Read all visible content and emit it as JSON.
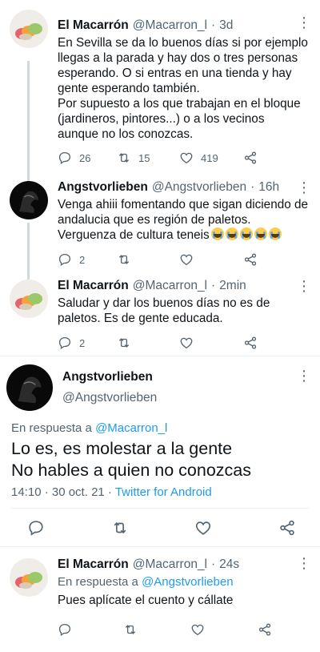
{
  "tweets": [
    {
      "name": "El Macarrón",
      "handle": "@Macarron_l",
      "time": "3d",
      "text": "En Sevilla se da lo buenos días si por ejemplo\nllegas a la parada y hay dos o tres personas\nesperando. O si entras en una tienda y hay\ngente esperando también.\nPor supuesto a los que trabajan en el bloque\n(jardineros, pintores...) o a los vecinos\naunque no los conozcas.",
      "replies": "26",
      "retweets": "15",
      "likes": "419"
    },
    {
      "name": "Angstvorlieben",
      "handle": "@Angstvorlieben",
      "time": "16h",
      "text": "Venga ahiii fomentando que sigan diciendo de\nandalucia que es región de paletos.\nVerguenza de cultura teneis",
      "replies": "2",
      "retweets": "",
      "likes": ""
    },
    {
      "name": "El Macarrón",
      "handle": "@Macarron_l",
      "time": "2min",
      "text": "Saludar y dar los buenos días no es de\npaletos. Es de gente educada.",
      "replies": "2",
      "retweets": "",
      "likes": ""
    }
  ],
  "focused": {
    "name": "Angstvorlieben",
    "handle": "@Angstvorlieben",
    "reply_prefix": "En respuesta a",
    "reply_to": "@Macarron_l",
    "text": "Lo es, es molestar a la gente\nNo hables a quien no conozcas",
    "date": "14:10 · 30 oct. 21 ·",
    "source": "Twitter for Android"
  },
  "last": {
    "name": "El Macarrón",
    "handle": "@Macarron_l",
    "time": "24s",
    "reply_prefix": "En respuesta a",
    "reply_to": "@Angstvorlieben",
    "text": "Pues aplícate el cuento y cállate"
  },
  "sep": "·",
  "more": "⋮",
  "icons": [
    "reply-icon",
    "retweet-icon",
    "like-icon",
    "share-icon",
    "more-icon"
  ],
  "colors": {
    "link": "#1d9bf0",
    "muted": "#536471",
    "text": "#0f1419"
  }
}
